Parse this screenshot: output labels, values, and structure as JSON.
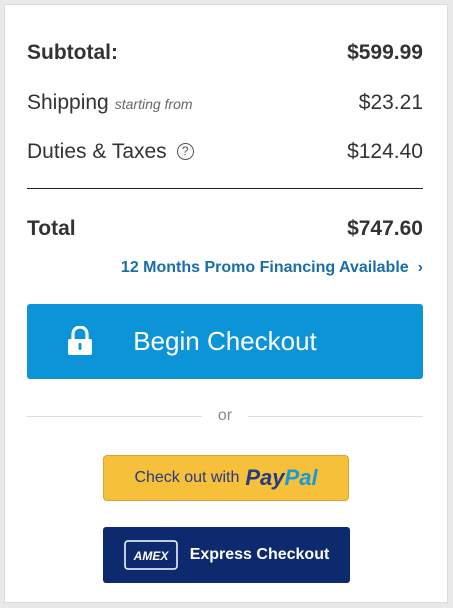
{
  "summary": {
    "subtotal_label": "Subtotal:",
    "subtotal_value": "$599.99",
    "shipping_label": "Shipping",
    "shipping_note": "starting from",
    "shipping_value": "$23.21",
    "duties_label": "Duties & Taxes",
    "duties_help": "?",
    "duties_value": "$124.40",
    "total_label": "Total",
    "total_value": "$747.60"
  },
  "promo": {
    "label": "12 Months Promo Financing Available",
    "chevron": "›"
  },
  "checkout": {
    "label": "Begin Checkout"
  },
  "separator": {
    "label": "or"
  },
  "paypal": {
    "prefix": "Check out with",
    "logo_pay": "Pay",
    "logo_pal": "Pal"
  },
  "amex": {
    "logo_text": "AMEX",
    "label": "Express Checkout"
  },
  "colors": {
    "checkout_blue": "#0c94d8",
    "link_blue": "#1a6ea8",
    "paypal_yellow": "#f7c03b",
    "amex_navy": "#0d2a6e"
  }
}
